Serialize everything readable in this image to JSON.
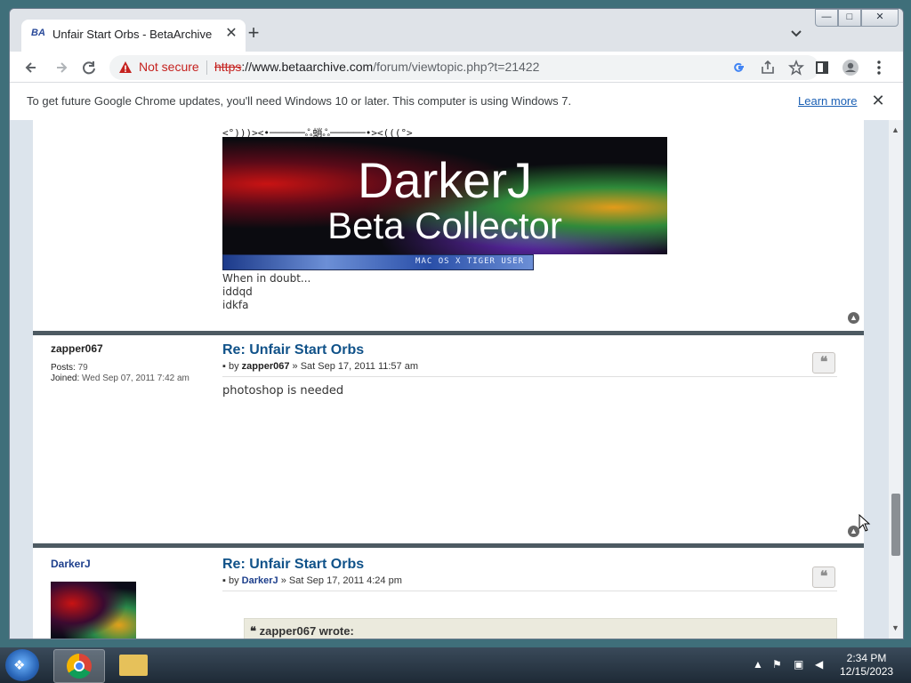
{
  "browser": {
    "tab_title": "Unfair Start Orbs - BetaArchive",
    "tab_favicon_text": "BA",
    "new_tab": "+",
    "tab_close": "✕",
    "not_secure": "Not secure",
    "url_protocol": "https",
    "url_host": "://www.betaarchive.com",
    "url_path": "/forum/viewtopic.php?t=21422",
    "window_buttons": {
      "minimize": "—",
      "maximize": "□",
      "close": "✕"
    },
    "icons": [
      "back-icon",
      "forward-icon",
      "reload-icon",
      "google-icon",
      "share-icon",
      "star-icon",
      "sidepanel-icon",
      "profile-icon",
      "menu-icon"
    ]
  },
  "infobar": {
    "text": "To get future Google Chrome updates, you'll need Windows 10 or later. This computer is using Windows 7.",
    "learn_more": "Learn more",
    "close": "✕"
  },
  "signature": {
    "ascii_line": "<°)))><•──────ஃ蛸ஃ──────•><(((°>",
    "banner_line1": "DarkerJ",
    "banner_line2": "Beta Collector",
    "userbar_text": "MAC OS X TIGER USER",
    "lines": [
      "When in doubt...",
      "iddqd",
      "idkfa"
    ]
  },
  "posts": [
    {
      "author": "zapper067",
      "posts_label": "Posts:",
      "posts_value": "79",
      "joined_label": "Joined:",
      "joined_value": "Wed Sep 07, 2011 7:42 am",
      "title": "Re: Unfair Start Orbs",
      "meta_by": "by",
      "meta_author": "zapper067",
      "meta_date": "» Sat Sep 17, 2011 11:57 am",
      "body": "photoshop is needed"
    },
    {
      "author": "DarkerJ",
      "title": "Re: Unfair Start Orbs",
      "meta_by": "by",
      "meta_author": "DarkerJ",
      "meta_date": "» Sat Sep 17, 2011 4:24 pm",
      "quote_header": "zapper067 wrote:"
    }
  ],
  "taskbar": {
    "time": "2:34 PM",
    "date": "12/15/2023"
  },
  "colors": {
    "link_blue": "#105289",
    "not_secure_red": "#c5221f",
    "divider": "#4d5a62",
    "quote_bg": "#ebeadd"
  }
}
